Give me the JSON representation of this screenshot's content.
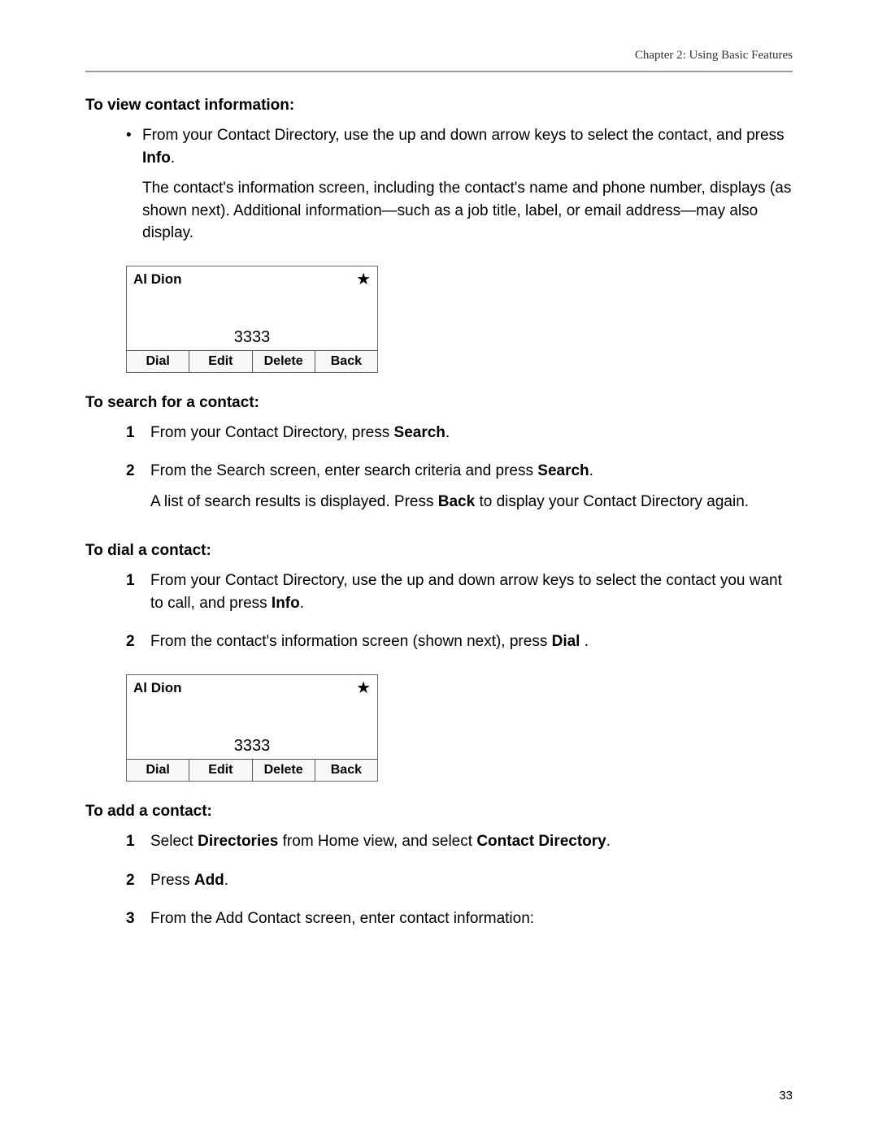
{
  "header": "Chapter 2: Using Basic Features",
  "pageNumber": "33",
  "s1": {
    "heading": "To view contact information:",
    "b1a": "From your Contact Directory, use the up and down arrow keys to select the contact, and press ",
    "b1b": "Info",
    "b1c": ".",
    "b1p2": "The contact's information screen, including the contact's name and phone number, displays (as shown next). Additional information—such as a job title, label, or email address—may also display."
  },
  "screen1": {
    "name": "Al Dion",
    "number": "3333",
    "k1": "Dial",
    "k2": "Edit",
    "k3": "Delete",
    "k4": "Back"
  },
  "s2": {
    "heading": "To search for a contact:",
    "n1a": "From your Contact Directory, press ",
    "n1b": "Search",
    "n1c": ".",
    "n2a": "From the Search screen, enter search criteria and press ",
    "n2b": "Search",
    "n2c": ".",
    "n2p2a": "A list of search results is displayed. Press ",
    "n2p2b": "Back",
    "n2p2c": " to display your Contact Directory again."
  },
  "s3": {
    "heading": "To dial a contact:",
    "n1a": "From your Contact Directory, use the up and down arrow keys to select the contact you want to call, and press ",
    "n1b": "Info",
    "n1c": ".",
    "n2a": "From the contact's information screen (shown next), press ",
    "n2b": "Dial",
    "n2c": " ."
  },
  "screen2": {
    "name": "Al Dion",
    "number": "3333",
    "k1": "Dial",
    "k2": "Edit",
    "k3": "Delete",
    "k4": "Back"
  },
  "s4": {
    "heading": "To add a contact:",
    "n1a": "Select ",
    "n1b": "Directories",
    "n1c": " from Home view, and select ",
    "n1d": "Contact Directory",
    "n1e": ".",
    "n2a": "Press ",
    "n2b": "Add",
    "n2c": ".",
    "n3": "From the Add Contact screen, enter contact information:"
  },
  "markers": {
    "bullet": "•",
    "m1": "1",
    "m2": "2",
    "m3": "3"
  },
  "star": "★"
}
